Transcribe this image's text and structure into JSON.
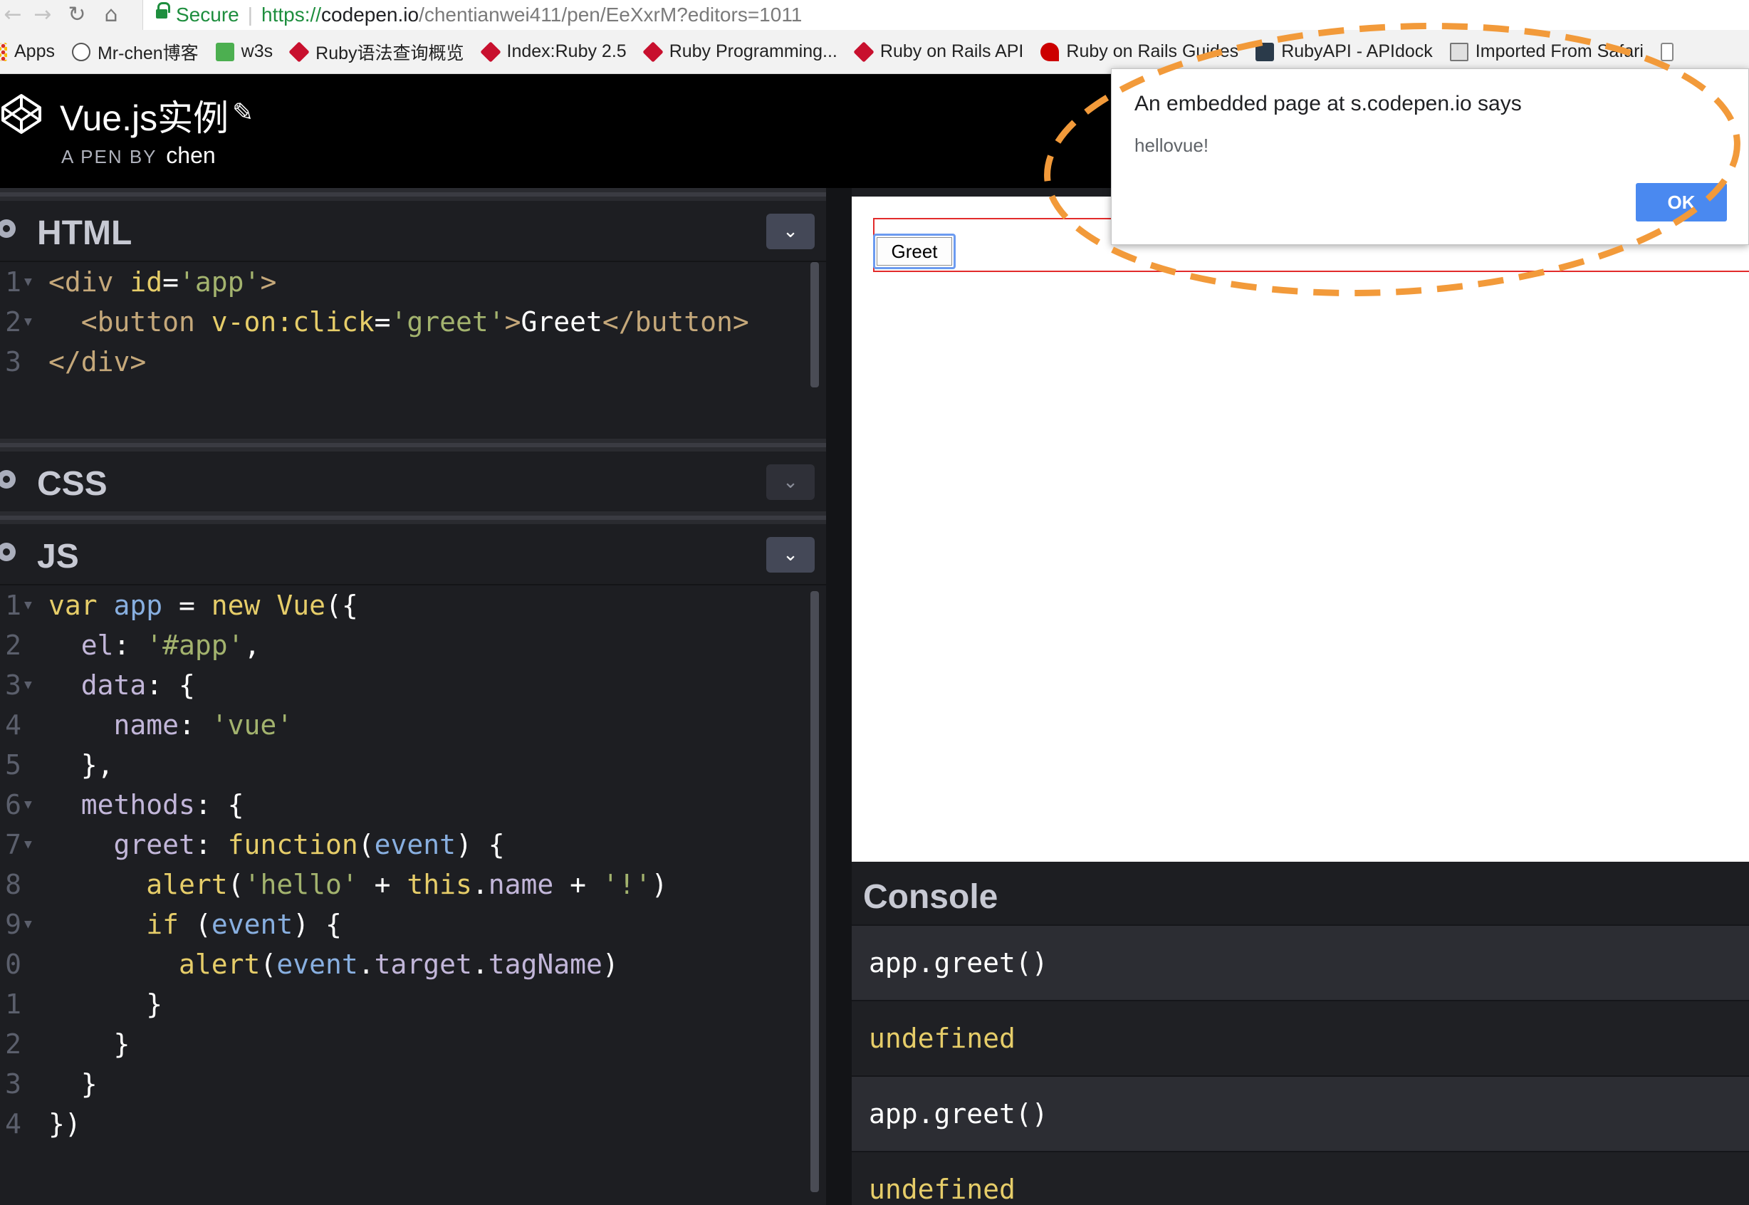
{
  "browser": {
    "secure_label": "Secure",
    "url_scheme": "https://",
    "url_host": "codepen.io",
    "url_path": "/chentianwei411/pen/EeXxrM?editors=1011"
  },
  "bookmarks": [
    {
      "label": "Apps",
      "icon": "apps-grid-icon"
    },
    {
      "label": "Mr-chen博客",
      "icon": "person-icon"
    },
    {
      "label": "w3s",
      "icon": "w3-icon"
    },
    {
      "label": "Ruby语法查询概览",
      "icon": "ruby-gem-icon"
    },
    {
      "label": "Index:Ruby 2.5",
      "icon": "ruby-gem-icon"
    },
    {
      "label": "Ruby Programming...",
      "icon": "ruby-gem-icon"
    },
    {
      "label": "Ruby on Rails API",
      "icon": "ruby-gem-icon"
    },
    {
      "label": "Ruby on Rails Guides",
      "icon": "rails-icon"
    },
    {
      "label": "RubyAPI - APIdock",
      "icon": "apidock-icon"
    },
    {
      "label": "Imported From Safari",
      "icon": "folder-icon"
    }
  ],
  "pen": {
    "title": "Vue.js实例",
    "byline": "A PEN BY",
    "author": "chen"
  },
  "editors": {
    "html_title": "HTML",
    "css_title": "CSS",
    "js_title": "JS"
  },
  "html_lines": [
    {
      "n": "1",
      "fold": true
    },
    {
      "n": "2",
      "fold": true
    },
    {
      "n": "3",
      "fold": false
    }
  ],
  "html_code": {
    "l1": [
      [
        "t-tag",
        "<div "
      ],
      [
        "t-attr",
        "id"
      ],
      [
        "t-pun",
        "="
      ],
      [
        "t-str",
        "'app'"
      ],
      [
        "t-tag",
        ">"
      ]
    ],
    "l2": [
      [
        "t-pun",
        "  "
      ],
      [
        "t-tag",
        "<button "
      ],
      [
        "t-attr",
        "v-on:click"
      ],
      [
        "t-pun",
        "="
      ],
      [
        "t-str",
        "'greet'"
      ],
      [
        "t-tag",
        ">"
      ],
      [
        "t-txt",
        "Greet"
      ],
      [
        "t-tag",
        "</button>"
      ]
    ],
    "l3": [
      [
        "t-tag",
        "</div>"
      ]
    ]
  },
  "js_lines": [
    {
      "n": "1",
      "fold": true
    },
    {
      "n": "2",
      "fold": false
    },
    {
      "n": "3",
      "fold": true
    },
    {
      "n": "4",
      "fold": false
    },
    {
      "n": "5",
      "fold": false
    },
    {
      "n": "6",
      "fold": true
    },
    {
      "n": "7",
      "fold": true
    },
    {
      "n": "8",
      "fold": false
    },
    {
      "n": "9",
      "fold": true
    },
    {
      "n": "0",
      "fold": false
    },
    {
      "n": "1",
      "fold": false
    },
    {
      "n": "2",
      "fold": false
    },
    {
      "n": "3",
      "fold": false
    },
    {
      "n": "4",
      "fold": false
    }
  ],
  "js_code": [
    [
      [
        "t-kw",
        "var "
      ],
      [
        "t-var",
        "app"
      ],
      [
        "t-pun",
        " = "
      ],
      [
        "t-kw",
        "new "
      ],
      [
        "t-fn",
        "Vue"
      ],
      [
        "t-pun",
        "({"
      ]
    ],
    [
      [
        "t-pun",
        "  "
      ],
      [
        "t-prop",
        "el"
      ],
      [
        "t-pun",
        ": "
      ],
      [
        "t-str",
        "'#app'"
      ],
      [
        "t-pun",
        ","
      ]
    ],
    [
      [
        "t-pun",
        "  "
      ],
      [
        "t-prop",
        "data"
      ],
      [
        "t-pun",
        ": {"
      ]
    ],
    [
      [
        "t-pun",
        "    "
      ],
      [
        "t-prop",
        "name"
      ],
      [
        "t-pun",
        ": "
      ],
      [
        "t-str",
        "'vue'"
      ]
    ],
    [
      [
        "t-pun",
        "  },"
      ]
    ],
    [
      [
        "t-pun",
        "  "
      ],
      [
        "t-prop",
        "methods"
      ],
      [
        "t-pun",
        ": {"
      ]
    ],
    [
      [
        "t-pun",
        "    "
      ],
      [
        "t-prop",
        "greet"
      ],
      [
        "t-pun",
        ": "
      ],
      [
        "t-kw",
        "function"
      ],
      [
        "t-pun",
        "("
      ],
      [
        "t-arg",
        "event"
      ],
      [
        "t-pun",
        ") {"
      ]
    ],
    [
      [
        "t-pun",
        "      "
      ],
      [
        "t-fn",
        "alert"
      ],
      [
        "t-pun",
        "("
      ],
      [
        "t-str",
        "'hello'"
      ],
      [
        "t-pun",
        " + "
      ],
      [
        "t-kw",
        "this"
      ],
      [
        "t-pun",
        "."
      ],
      [
        "t-prop",
        "name"
      ],
      [
        "t-pun",
        " + "
      ],
      [
        "t-str",
        "'!'"
      ],
      [
        "t-pun",
        ")"
      ]
    ],
    [
      [
        "t-pun",
        "      "
      ],
      [
        "t-kw",
        "if "
      ],
      [
        "t-pun",
        "("
      ],
      [
        "t-arg",
        "event"
      ],
      [
        "t-pun",
        ") {"
      ]
    ],
    [
      [
        "t-pun",
        "        "
      ],
      [
        "t-fn",
        "alert"
      ],
      [
        "t-pun",
        "("
      ],
      [
        "t-arg",
        "event"
      ],
      [
        "t-pun",
        "."
      ],
      [
        "t-prop",
        "target"
      ],
      [
        "t-pun",
        "."
      ],
      [
        "t-prop",
        "tagName"
      ],
      [
        "t-pun",
        ")"
      ]
    ],
    [
      [
        "t-pun",
        "      }"
      ]
    ],
    [
      [
        "t-pun",
        "    }"
      ]
    ],
    [
      [
        "t-pun",
        "  }"
      ]
    ],
    [
      [
        "t-pun",
        "})"
      ]
    ]
  ],
  "preview": {
    "greet_label": "Greet"
  },
  "alert": {
    "title": "An embedded page at s.codepen.io says",
    "message": "hellovue!",
    "ok_label": "OK"
  },
  "console": {
    "title": "Console",
    "rows": [
      {
        "kind": "in",
        "text": "app.greet()"
      },
      {
        "kind": "out",
        "text": "undefined"
      },
      {
        "kind": "in",
        "text": "app.greet()"
      },
      {
        "kind": "out",
        "text": "undefined"
      }
    ]
  },
  "colors": {
    "accent_blue": "#4a89f0",
    "secure_green": "#1e8e3e",
    "highlight_orange": "#f29a3a"
  }
}
